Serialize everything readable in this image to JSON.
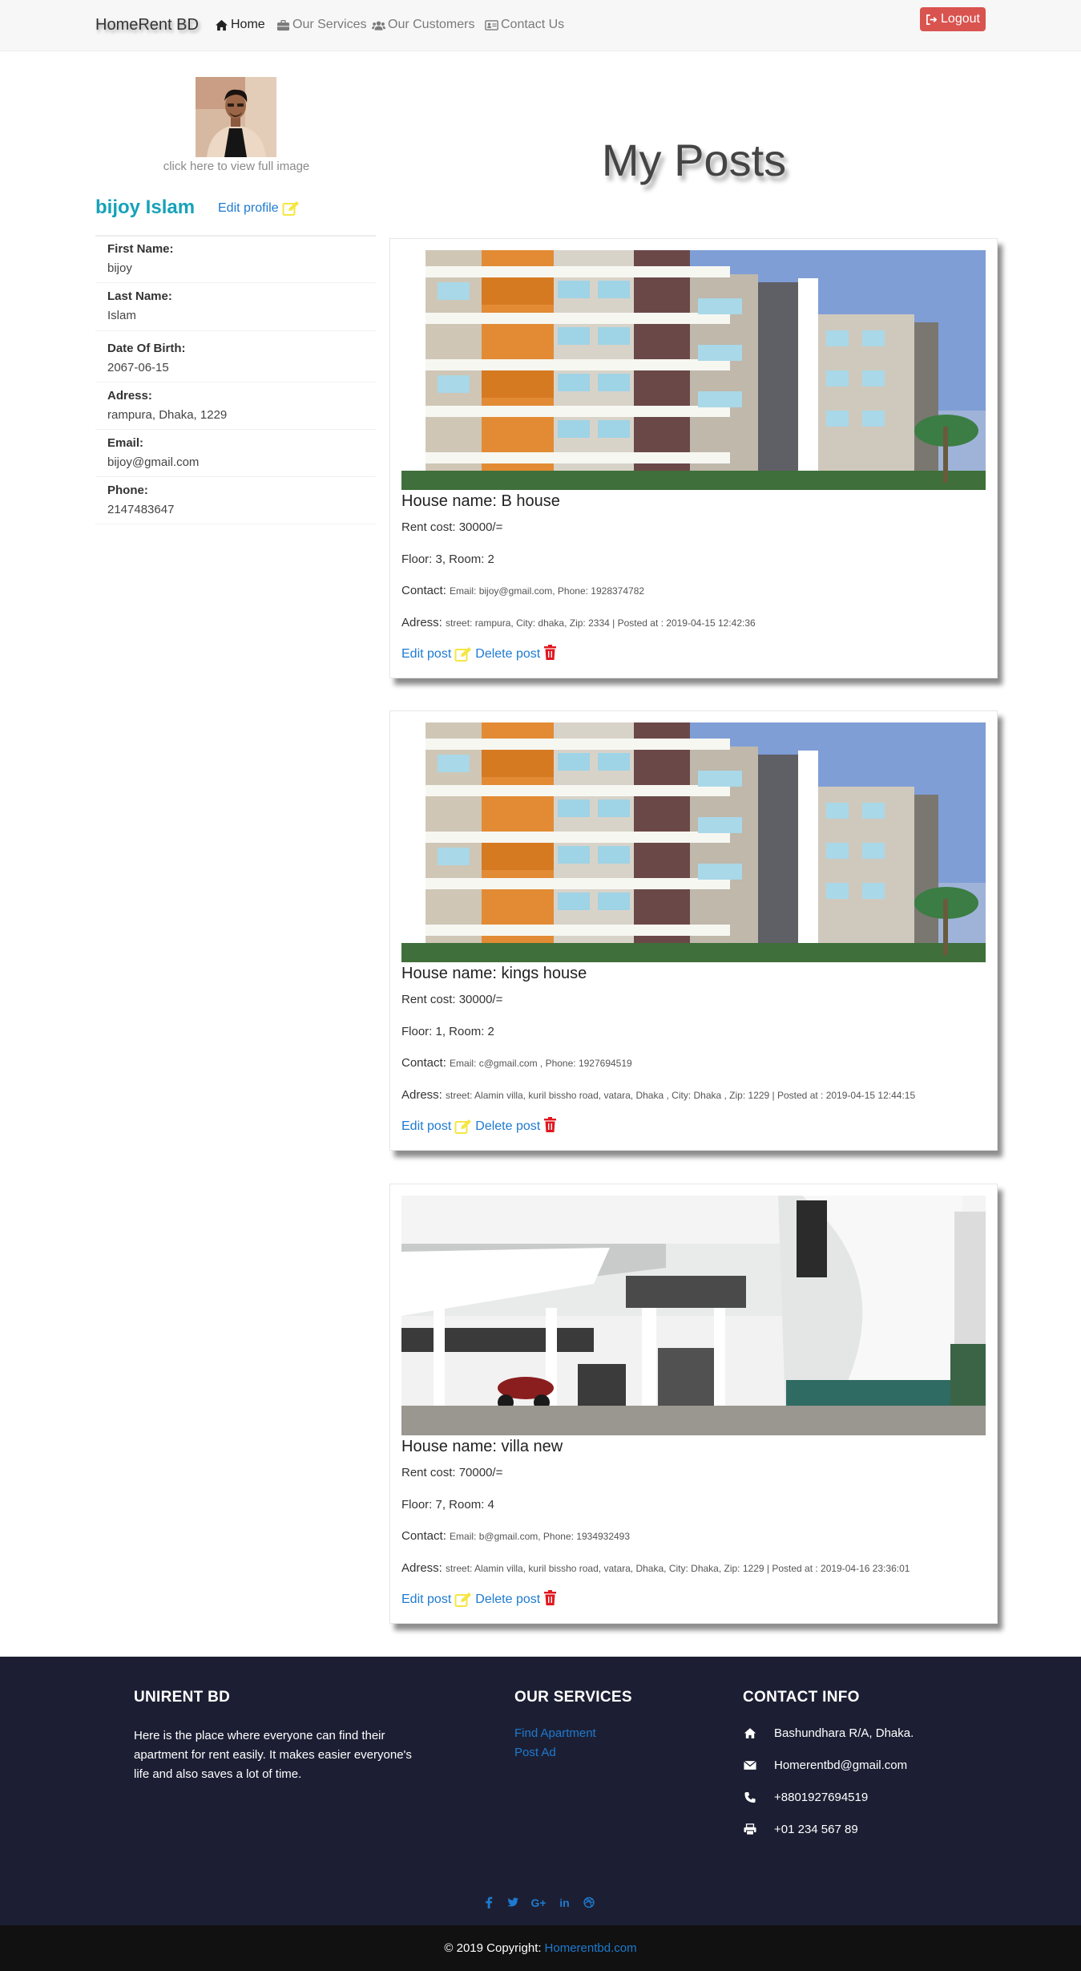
{
  "navbar": {
    "brand": "HomeRent BD",
    "links": [
      {
        "label": "Home",
        "icon": "home-icon"
      },
      {
        "label": "Our Services",
        "icon": "briefcase-icon"
      },
      {
        "label": "Our Customers",
        "icon": "users-icon"
      },
      {
        "label": "Contact Us",
        "icon": "address-card-icon"
      }
    ],
    "logout_label": "Logout"
  },
  "profile": {
    "avatar_caption": "click here to view full image",
    "name": "bijoy Islam",
    "edit_label": "Edit profile",
    "fields": [
      {
        "label": "First Name:",
        "value": "bijoy"
      },
      {
        "label": "Last Name:",
        "value": "Islam"
      },
      {
        "label": "Date Of Birth:",
        "value": "2067-06-15"
      },
      {
        "label": "Adress:",
        "value": "rampura, Dhaka, 1229"
      },
      {
        "label": "Email:",
        "value": "bijoy@gmail.com"
      },
      {
        "label": "Phone:",
        "value": "2147483647"
      }
    ]
  },
  "main": {
    "title": "My Posts",
    "posts": [
      {
        "house_name": "House name: B house",
        "rent": "Rent cost: 30000/=",
        "floor_room": "Floor: 3, Room: 2",
        "contact_label": "Contact:",
        "contact": "Email: bijoy@gmail.com, Phone: 1928374782",
        "address_label": "Adress:",
        "address": "street: rampura, City: dhaka, Zip: 2334 | Posted at : 2019-04-15 12:42:36",
        "edit_label": "Edit post",
        "delete_label": "Delete post",
        "image": "apartment-building"
      },
      {
        "house_name": "House name: kings house",
        "rent": "Rent cost: 30000/=",
        "floor_room": "Floor: 1, Room: 2",
        "contact_label": "Contact:",
        "contact": "Email: c@gmail.com , Phone: 1927694519",
        "address_label": "Adress:",
        "address": "street: Alamin villa, kuril bissho road, vatara, Dhaka , City: Dhaka , Zip: 1229 | Posted at : 2019-04-15 12:44:15",
        "edit_label": "Edit post",
        "delete_label": "Delete post",
        "image": "apartment-building"
      },
      {
        "house_name": "House name: villa new",
        "rent": "Rent cost: 70000/=",
        "floor_room": "Floor: 7, Room: 4",
        "contact_label": "Contact:",
        "contact": "Email: b@gmail.com, Phone: 1934932493",
        "address_label": "Adress:",
        "address": "street: Alamin villa, kuril bissho road, vatara, Dhaka, City: Dhaka, Zip: 1229 | Posted at : 2019-04-16 23:36:01",
        "edit_label": "Edit post",
        "delete_label": "Delete post",
        "image": "white-villa"
      }
    ]
  },
  "footer": {
    "about_heading": "UNIRENT BD",
    "about_text": "Here is the place where everyone can find their apartment for rent easily. It makes easier everyone's life and also saves a lot of time.",
    "services_heading": "OUR SERVICES",
    "services": [
      "Find Apartment",
      "Post Ad"
    ],
    "contact_heading": "CONTACT INFO",
    "contacts": [
      {
        "icon": "home-icon",
        "text": "Bashundhara R/A, Dhaka."
      },
      {
        "icon": "envelope-icon",
        "text": "Homerentbd@gmail.com"
      },
      {
        "icon": "phone-icon",
        "text": "+8801927694519"
      },
      {
        "icon": "print-icon",
        "text": "+01 234 567 89"
      }
    ],
    "socials": [
      "facebook-icon",
      "twitter-icon",
      "google-plus-icon",
      "linkedin-icon",
      "dribbble-icon"
    ],
    "copyright_prefix": "© 2019 Copyright:",
    "copyright_link": "Homerentbd.com"
  },
  "colors": {
    "accent_link": "#1e7ad0",
    "profile_name": "#17a2b8",
    "logout": "#d9534f",
    "edit_icon": "#f5e642",
    "delete_icon": "#e0181f",
    "footer_bg": "#1c1f33"
  }
}
